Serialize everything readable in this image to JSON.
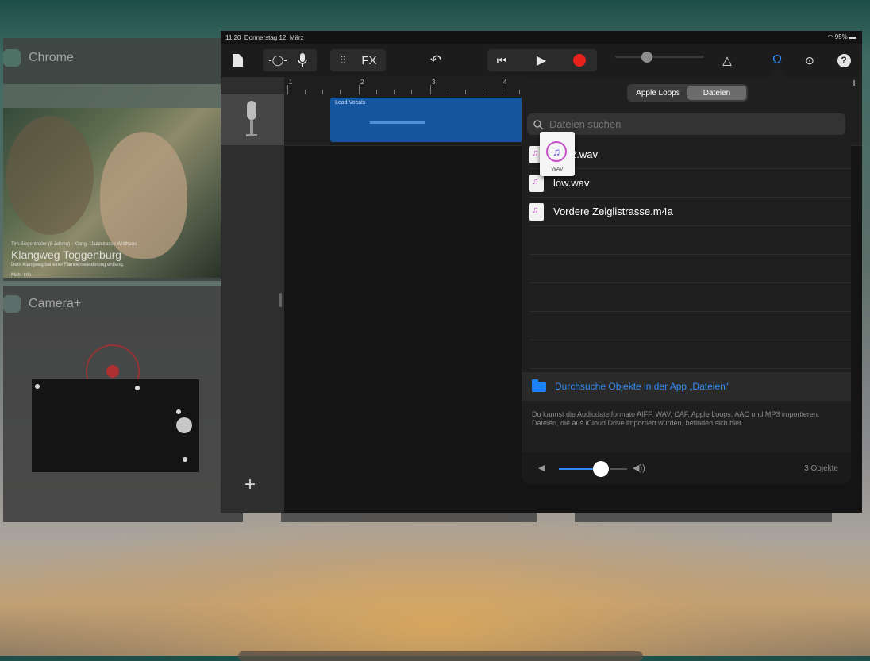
{
  "switcher": {
    "chrome": {
      "label": "Chrome"
    },
    "photo": {
      "caption_small": "Tim Siegenthaler (8 Jahren) - Klang - Jazzstrasse Wildhaus",
      "caption_big": "Klangweg Toggenburg",
      "caption_text": "Dem Klangweg bei einer Familienwanderung entlang.",
      "caption_more": "Mehr Info"
    },
    "camera": {
      "label": "Camera+"
    }
  },
  "statusbar": {
    "time": "11:20",
    "date": "Donnerstag 12. März",
    "battery": "95%"
  },
  "toolbar": {
    "fx_label": "FX",
    "colors": {
      "accent": "#2f8cf6",
      "record": "#e8231c"
    }
  },
  "ruler": {
    "bars": [
      "1",
      "2",
      "3",
      "4"
    ]
  },
  "track": {
    "region_title": "Lead Vocals"
  },
  "browser": {
    "tabs": [
      "Apple Loops",
      "Dateien"
    ],
    "active_tab": "Dateien",
    "search_placeholder": "Dateien suchen",
    "files": [
      {
        "name": "2.wav"
      },
      {
        "name": "low.wav"
      },
      {
        "name": "Vordere Zelglistrasse.m4a"
      }
    ],
    "browse_label": "Durchsuche Objekte in der App „Dateien“",
    "info_text": "Du kannst die Audiodateiformate AIFF, WAV, CAF, Apple Loops, AAC und MP3 importieren. Dateien, die aus iCloud Drive importiert wurden, befinden sich hier.",
    "count_label": "3 Objekte",
    "volume": 0.62
  },
  "drag": {
    "ext": "WAV"
  }
}
